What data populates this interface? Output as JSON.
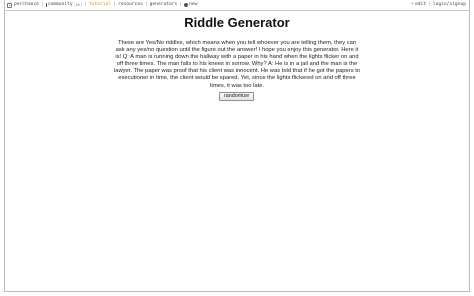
{
  "nav": {
    "brand": "perchance",
    "community": "community",
    "community_count": "(88)",
    "tutorial": "tutorial",
    "resources": "resources",
    "generators": "generators",
    "new": "new",
    "add_symbol": "+",
    "edit": "edit",
    "login": "login/signup",
    "separator": "|"
  },
  "page": {
    "title": "Riddle Generator",
    "description": "These are Yes/No riddles, which means when you tell whoever you are telling them, they can ask any yes/no question until the figure out the answer! I hope you enjoy this generator. Here it is! Q: A man is running down the hallway with a paper in his hand when the lights flicker on and off three times. The man falls to his knees in sorrow. Why? A: He is in a jail and the man is the lawyer. The paper was proof that his client was innocent. He was told that if he got the papers to executioner in time, the client would be spared. Yet, since the lights flickered on and off three times, it was too late.",
    "button_label": "randomize"
  },
  "colors": {
    "active_nav": "#d28a1d",
    "add_green": "#2e8b2e"
  }
}
